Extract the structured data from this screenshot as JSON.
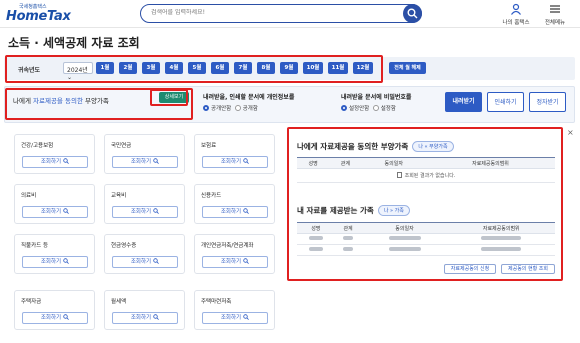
{
  "header": {
    "logo_sub": "국세청홈택스",
    "logo_main": "HomeTax",
    "search_placeholder": "검색어를 입력하세요!",
    "my_label": "나의 홈택스",
    "menu_label": "전체메뉴"
  },
  "page": {
    "title": "소득 · 세액공제 자료 조회"
  },
  "year_bar": {
    "label": "귀속년도",
    "year_value": "2024년",
    "months": [
      "1월",
      "2월",
      "3월",
      "4월",
      "5월",
      "6월",
      "7월",
      "8월",
      "9월",
      "10월",
      "11월",
      "12월"
    ],
    "all_months_label": "전체 월 해제"
  },
  "consent": {
    "title_prefix": "나에게 ",
    "title_highlight": "자료제공을 동의한",
    "title_suffix": " 부양가족",
    "detail_button": "상세보기",
    "print_option": {
      "title": "내려받을, 인쇄할 문서에 개인정보를",
      "choices": [
        "공개안함",
        "공개함"
      ],
      "selected": "공개안함"
    },
    "password_option": {
      "title": "내려받을 문서에 비밀번호를",
      "choices": [
        "설정안함",
        "설정함"
      ],
      "selected": "설정안함"
    },
    "actions": {
      "download": "내려받기",
      "print": "인쇄하기",
      "pdf": "정자받기"
    }
  },
  "categories": [
    {
      "title": "건강/고용보험",
      "button": "조회하기"
    },
    {
      "title": "국민연금",
      "button": "조회하기"
    },
    {
      "title": "보험료",
      "button": "조회하기"
    },
    {
      "title": "의료비",
      "button": "조회하기"
    },
    {
      "title": "교육비",
      "button": "조회하기"
    },
    {
      "title": "신용카드",
      "button": "조회하기"
    },
    {
      "title": "직불카드 등",
      "button": "조회하기"
    },
    {
      "title": "현금영수증",
      "button": "조회하기"
    },
    {
      "title": "개인연금저축/연금계좌",
      "button": "조회하기"
    },
    {
      "title": "주택자금",
      "button": "조회하기"
    },
    {
      "title": "월세액",
      "button": "조회하기"
    },
    {
      "title": "주택마련저축",
      "button": "조회하기"
    }
  ],
  "panel": {
    "section1": {
      "title": "나에게 자료제공을 동의한 부양가족",
      "tag": "나 « 부양가족",
      "columns": [
        "성명",
        "관계",
        "동의일자",
        "자료제공동의범위"
      ],
      "empty_message": "조회된 결과가 없습니다."
    },
    "section2": {
      "title": "내 자료를 제공받는 가족",
      "tag": "나 » 가족",
      "columns": [
        "성명",
        "관계",
        "동의일자",
        "자료제공동의범위"
      ]
    },
    "buttons": {
      "consent_apply": "자료제공동의 신청",
      "consent_status": "제공동의 현황 조회"
    }
  }
}
